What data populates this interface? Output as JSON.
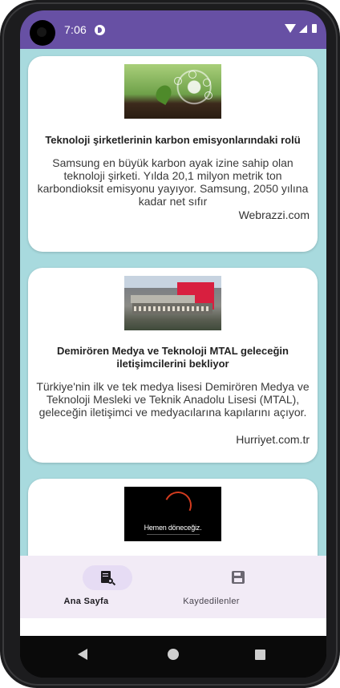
{
  "status_bar": {
    "time": "7:06",
    "background": "#6750a4"
  },
  "content": {
    "background": "#a8dade"
  },
  "articles": [
    {
      "image": "carbon-emission-plant-image",
      "title": "Teknoloji şirketlerinin karbon emisyonlarındaki rolü",
      "summary": "Samsung en büyük karbon ayak izine sahip olan teknoloji şirketi. Yılda 20,1 milyon metrik ton karbondioksit emisyonu yayıyor. Samsung, 2050 yılına kadar net sıfır",
      "source": "Webrazzi.com"
    },
    {
      "image": "media-building-image",
      "title": "Demirören Medya ve Teknoloji MTAL geleceğin iletişimcilerini bekliyor",
      "summary": "Türkiye'nin ilk ve tek medya lisesi Demirören Medya ve Teknoloji Mesleki ve Teknik Anadolu Lisesi (MTAL), geleceğin iletişimci ve medyacılarına kapılarını açıyor.",
      "source": "Hurriyet.com.tr"
    },
    {
      "image": "dark-teaser-image",
      "image_text": "Hemen döneceğiz."
    }
  ],
  "bottom_nav": {
    "items": [
      {
        "label": "Ana Sayfa",
        "icon": "document-search-icon",
        "active": true
      },
      {
        "label": "Kaydedilenler",
        "icon": "save-icon",
        "active": false
      }
    ]
  }
}
